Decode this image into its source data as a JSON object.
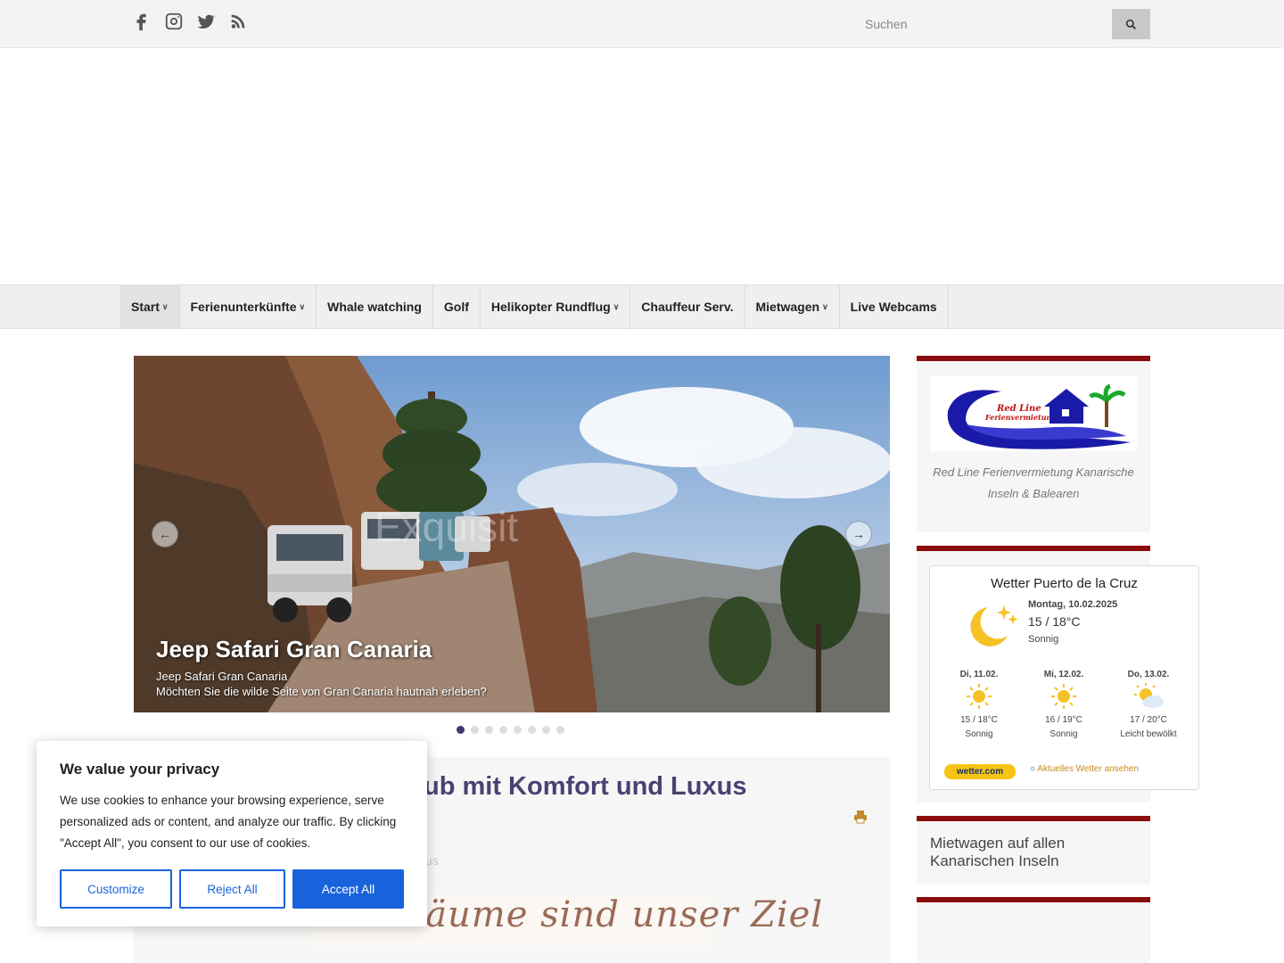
{
  "search": {
    "placeholder": "Suchen"
  },
  "social": [
    "facebook-icon",
    "instagram-icon",
    "twitter-icon",
    "rss-icon"
  ],
  "nav": [
    {
      "label": "Start",
      "dropdown": true
    },
    {
      "label": "Ferienunterkünfte",
      "dropdown": true
    },
    {
      "label": "Whale watching",
      "dropdown": false
    },
    {
      "label": "Golf",
      "dropdown": false
    },
    {
      "label": "Helikopter Rundflug",
      "dropdown": true
    },
    {
      "label": "Chauffeur Serv.",
      "dropdown": false
    },
    {
      "label": "Mietwagen",
      "dropdown": true
    },
    {
      "label": "Live Webcams",
      "dropdown": false
    }
  ],
  "slider": {
    "watermark": "Exquisit",
    "title": "Jeep Safari Gran Canaria",
    "line1": "Jeep Safari Gran Canaria",
    "line2": "Möchten Sie die wilde Seite von Gran Canaria hautnah erleben?",
    "slide_count": 8,
    "active_slide": 1
  },
  "article": {
    "title_visible": "ub mit Komfort und Luxus",
    "faded_text": "xus",
    "banner_text": "Ihr Träume sind unser Ziel"
  },
  "sidebar": {
    "logo_caption": "Red Line Ferienvermietung Kanarische Inseln & Balearen",
    "mietwagen_title": "Mietwagen auf allen Kanarischen Inseln"
  },
  "weather": {
    "title": "Wetter Puerto de la Cruz",
    "today_date": "Montag, 10.02.2025",
    "today_temp": "15 / 18°C",
    "today_cond": "Sonnig",
    "forecast": [
      {
        "day": "Di, 11.02.",
        "temp": "15 / 18°C",
        "cond": "Sonnig",
        "icon": "sun-icon"
      },
      {
        "day": "Mi, 12.02.",
        "temp": "16 / 19°C",
        "cond": "Sonnig",
        "icon": "sun-icon"
      },
      {
        "day": "Do, 13.02.",
        "temp": "17 / 20°C",
        "cond": "Leicht bewölkt",
        "icon": "partly-cloudy-icon"
      }
    ],
    "brand": "wetter.com",
    "link": "Aktuelles Wetter ansehen"
  },
  "cookie": {
    "title": "We value your privacy",
    "text": "We use cookies to enhance your browsing experience, serve personalized ads or content, and analyze our traffic. By clicking \"Accept All\", you consent to our use of cookies.",
    "customize": "Customize",
    "reject": "Reject All",
    "accept": "Accept All"
  },
  "colors": {
    "accent_red": "#8b0d0d",
    "title_purple": "#4a4170",
    "cookie_blue": "#1863dc"
  }
}
